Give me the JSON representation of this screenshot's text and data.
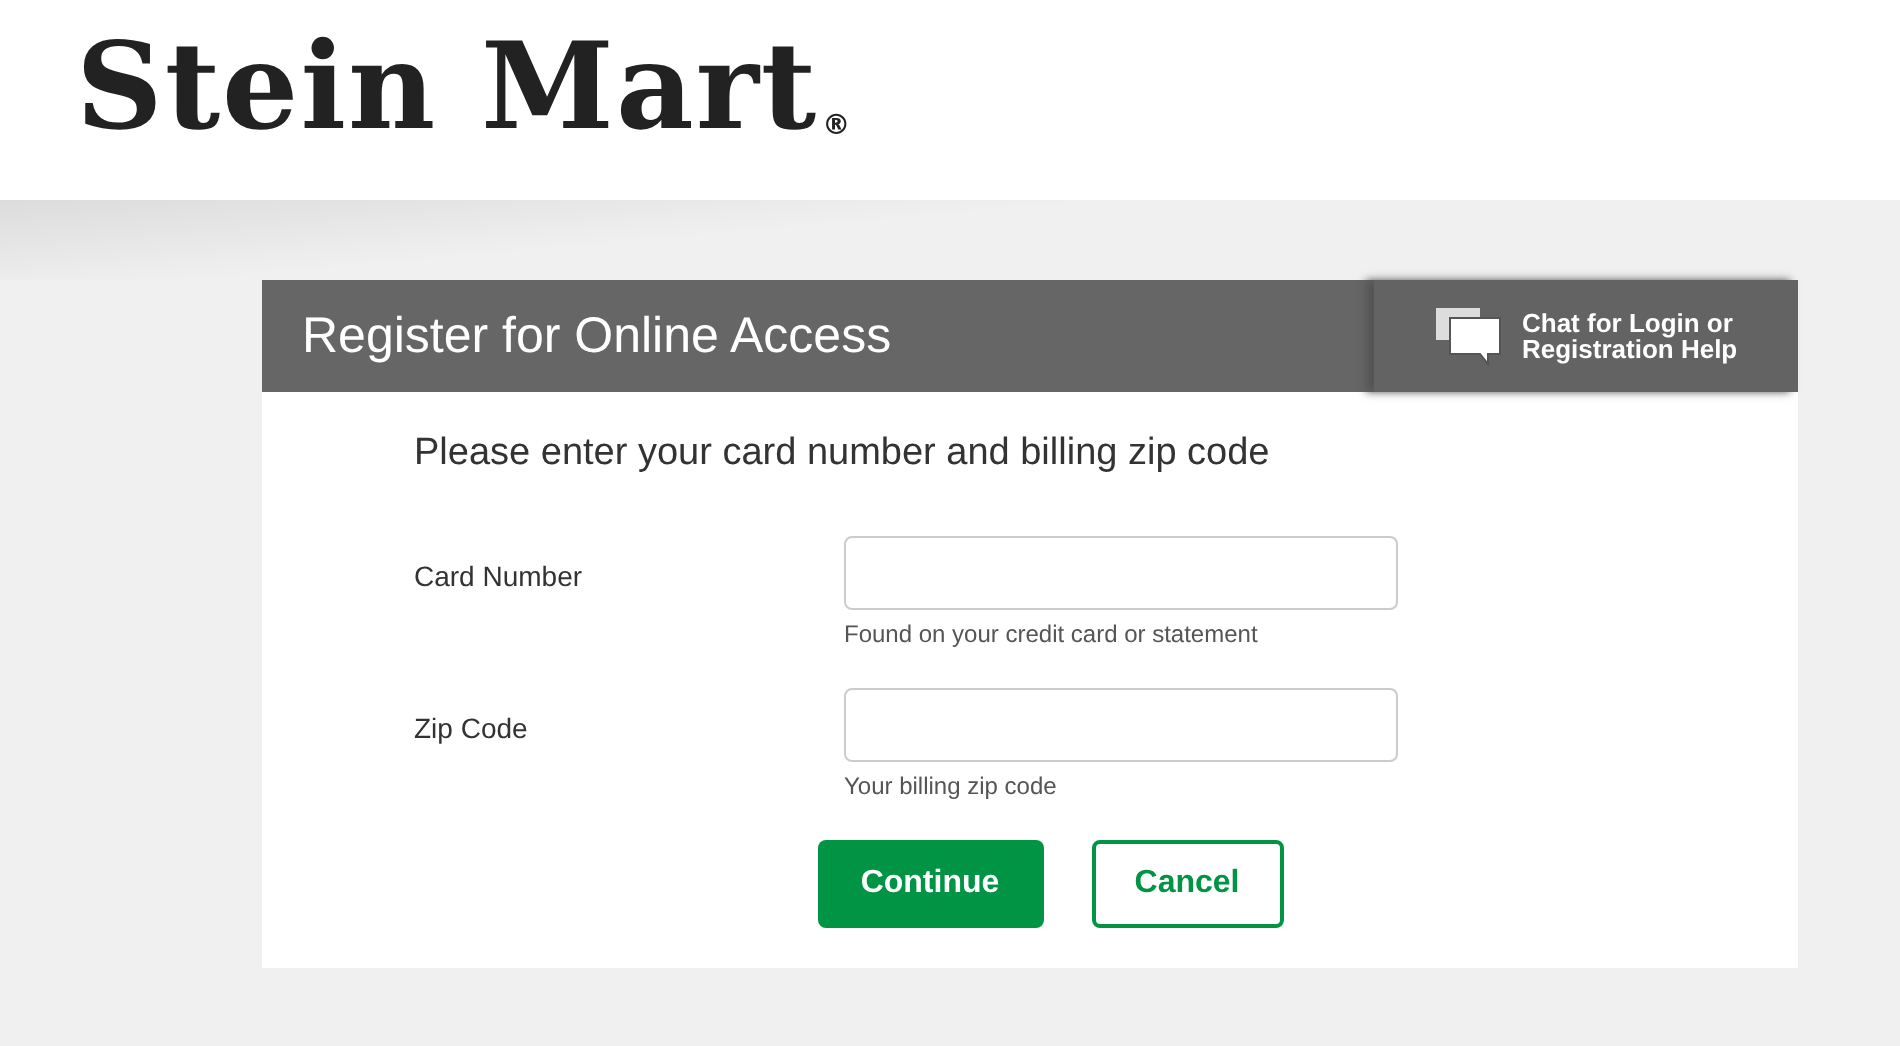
{
  "logo": {
    "text": "Stein Mart",
    "mark": "®"
  },
  "panel": {
    "title": "Register for Online Access",
    "chat_link": "Chat for Login or Registration Help"
  },
  "instructions": "Please enter your card number and billing zip code",
  "fields": [
    {
      "label": "Card Number",
      "hint": "Found on your credit card or statement"
    },
    {
      "label": "Zip Code",
      "hint": "Your billing zip code"
    }
  ],
  "buttons": [
    {
      "label": "Continue",
      "kind": "primary"
    },
    {
      "label": "Cancel",
      "kind": "secondary"
    }
  ]
}
